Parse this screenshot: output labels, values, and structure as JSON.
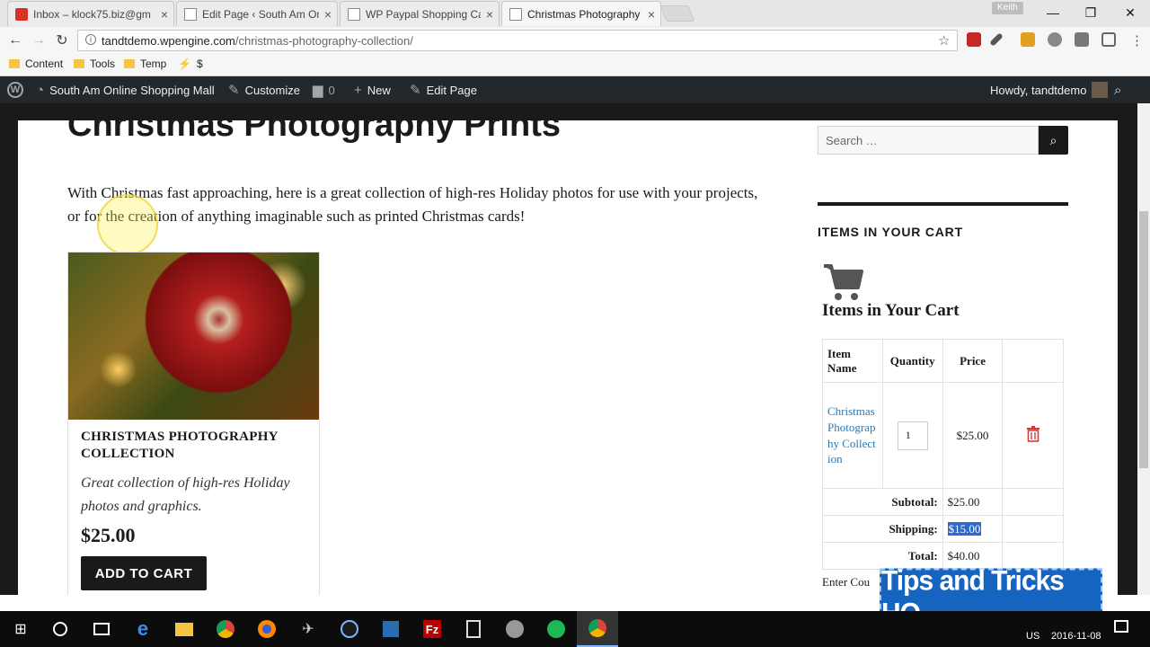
{
  "browser": {
    "tabs": [
      {
        "title": "Inbox – klock75.biz@gm",
        "close": "×"
      },
      {
        "title": "Edit Page ‹ South Am On",
        "close": "×"
      },
      {
        "title": "WP Paypal Shopping Car",
        "close": "×"
      },
      {
        "title": "Christmas Photography P",
        "close": "×"
      }
    ],
    "profile_name": "Keith",
    "url_host": "tandtdemo.wpengine.com",
    "url_path": "/christmas-photography-collection/",
    "bookmarks": [
      "Content",
      "Tools",
      "Temp",
      "$"
    ]
  },
  "adminbar": {
    "site_name": "South Am Online Shopping Mall",
    "customize": "Customize",
    "comments_count": "0",
    "new": "New",
    "edit_page": "Edit Page",
    "howdy": "Howdy, tandtdemo"
  },
  "page": {
    "title": "Christmas Photography Prints",
    "intro": "With Christmas fast approaching, here is a great collection of high-res Holiday photos for use with your projects, or for the creation of anything imaginable such as printed Christmas cards!"
  },
  "product": {
    "name": "CHRISTMAS PHOTOGRAPHY COLLECTION",
    "description": "Great collection of high-res Holiday photos and graphics.",
    "price": "$25.00",
    "add_to_cart": "ADD TO CART"
  },
  "sidebar": {
    "search_placeholder": "Search …",
    "widget_title": "ITEMS IN YOUR CART",
    "cart_heading": "Items in Your Cart",
    "table": {
      "headers": [
        "Item Name",
        "Quantity",
        "Price"
      ],
      "item": {
        "name": "Christmas Photography Collection",
        "quantity": "1",
        "price": "$25.00"
      },
      "subtotal_label": "Subtotal:",
      "subtotal": "$25.00",
      "shipping_label": "Shipping:",
      "shipping": "$15.00",
      "total_label": "Total:",
      "total": "$40.00"
    },
    "coupon_label": "Enter Cou"
  },
  "overlay": {
    "watermark": "Tips and Tricks HQ"
  },
  "taskbar": {
    "lang": "US",
    "date": "2016-11-08"
  },
  "colors": {
    "accent_link": "#2a7bb6",
    "adminbar": "#23282d",
    "watermark": "#1565c0"
  }
}
